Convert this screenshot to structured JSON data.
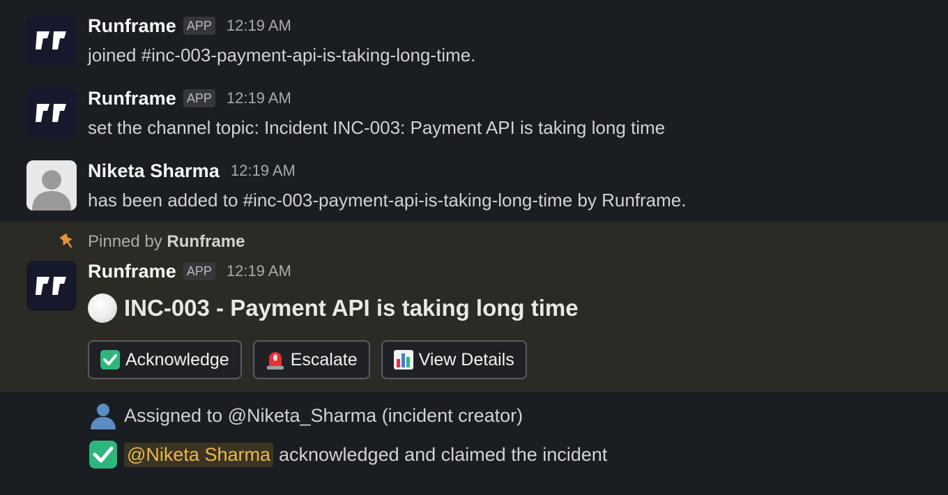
{
  "messages": [
    {
      "sender": "Runframe",
      "badge": "APP",
      "time": "12:19 AM",
      "text": "joined #inc-003-payment-api-is-taking-long-time."
    },
    {
      "sender": "Runframe",
      "badge": "APP",
      "time": "12:19 AM",
      "text": "set the channel topic: Incident INC-003: Payment API is taking long time"
    },
    {
      "sender": "Niketa Sharma",
      "time": "12:19 AM",
      "text": "has been added to #inc-003-payment-api-is-taking-long-time by Runframe."
    }
  ],
  "pinned": {
    "prefix": "Pinned by ",
    "by": "Runframe"
  },
  "incident": {
    "sender": "Runframe",
    "badge": "APP",
    "time": "12:19 AM",
    "title": "INC-003 - Payment API is taking long time",
    "status_icon": "white-circle-icon",
    "buttons": [
      {
        "label": "Acknowledge",
        "icon": "check-mark-button-icon"
      },
      {
        "label": "Escalate",
        "icon": "police-light-icon"
      },
      {
        "label": "View Details",
        "icon": "bar-chart-icon"
      }
    ]
  },
  "followups": {
    "assigned": "Assigned to @Niketa_Sharma (incident creator)",
    "ack_mention": "@Niketa Sharma",
    "ack_text": "acknowledged and claimed the incident"
  },
  "colors": {
    "background": "#1a1d21",
    "pinned_background": "#2c2a24",
    "mention_text": "#e8b84a",
    "pin_icon": "#e8923a",
    "check_green": "#2eb67d"
  }
}
